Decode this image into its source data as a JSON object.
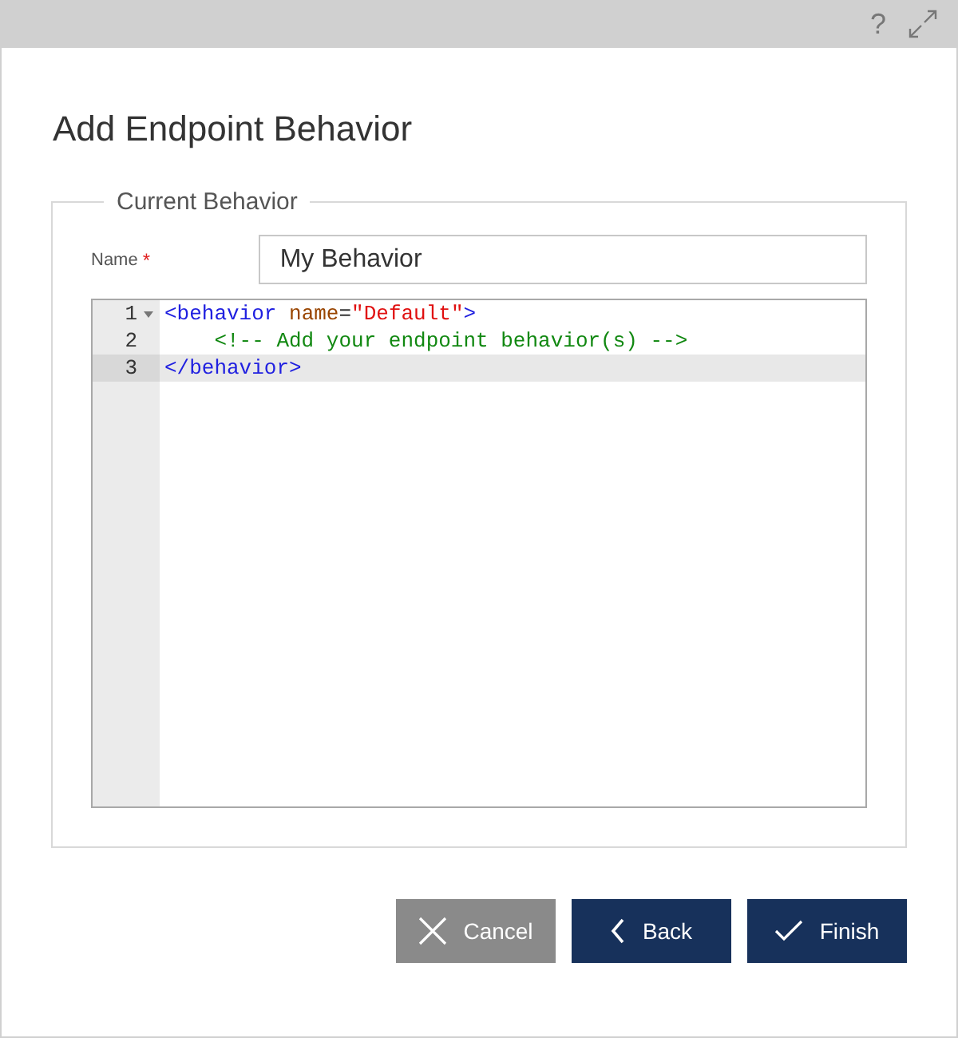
{
  "title_bar": {
    "help": "?"
  },
  "dialog": {
    "title": "Add Endpoint Behavior"
  },
  "group": {
    "legend": "Current Behavior",
    "name_field": {
      "label": "Name",
      "required_mark": "*",
      "value": "My Behavior"
    },
    "editor": {
      "lines": [
        {
          "number": "1",
          "foldable": true,
          "active": false,
          "indented": false,
          "tokens": [
            {
              "kind": "tag",
              "text": "<behavior"
            },
            {
              "kind": "attr",
              "text": "name"
            },
            {
              "kind": "plain",
              "text": "="
            },
            {
              "kind": "string",
              "text": "\"Default\""
            },
            {
              "kind": "tag",
              "text": ">"
            }
          ]
        },
        {
          "number": "2",
          "foldable": false,
          "active": false,
          "indented": true,
          "tokens": [
            {
              "kind": "comment",
              "text": "<!-- Add your endpoint behavior(s) -->"
            }
          ]
        },
        {
          "number": "3",
          "foldable": false,
          "active": true,
          "indented": false,
          "tokens": [
            {
              "kind": "tag",
              "text": "</behavior>"
            }
          ]
        }
      ]
    }
  },
  "buttons": [
    {
      "kind": "cancel",
      "label": "Cancel"
    },
    {
      "kind": "back",
      "label": "Back"
    },
    {
      "kind": "finish",
      "label": "Finish"
    }
  ]
}
